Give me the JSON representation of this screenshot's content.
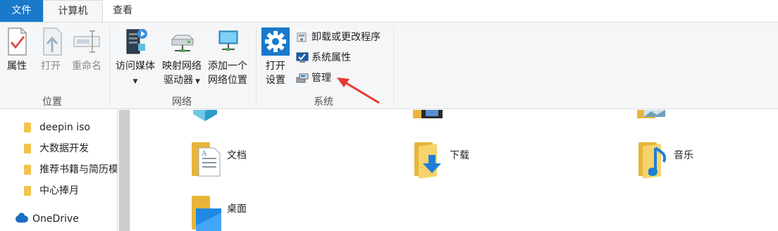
{
  "tabs": {
    "file": "文件",
    "computer": "计算机",
    "view": "查看"
  },
  "ribbon": {
    "location_group": {
      "label": "位置",
      "properties": "属性",
      "open": "打开",
      "rename": "重命名"
    },
    "network_group": {
      "label": "网络",
      "access_media": "访问媒体",
      "map_drive_line1": "映射网络",
      "map_drive_line2": "驱动器",
      "add_location_line1": "添加一个",
      "add_location_line2": "网络位置"
    },
    "system_group": {
      "label": "系统",
      "open_settings_line1": "打开",
      "open_settings_line2": "设置",
      "uninstall": "卸载或更改程序",
      "system_properties": "系统属性",
      "manage": "管理"
    }
  },
  "nav": {
    "items": [
      "deepin iso",
      "大数据开发",
      "推荐书籍与简历模",
      "中心捧月"
    ],
    "onedrive": "OneDrive"
  },
  "content": {
    "folders": [
      "文档",
      "下载",
      "音乐",
      "桌面"
    ]
  },
  "colors": {
    "accent": "#1979ca",
    "arrow": "#e53935",
    "folder": "#f7d36b"
  }
}
